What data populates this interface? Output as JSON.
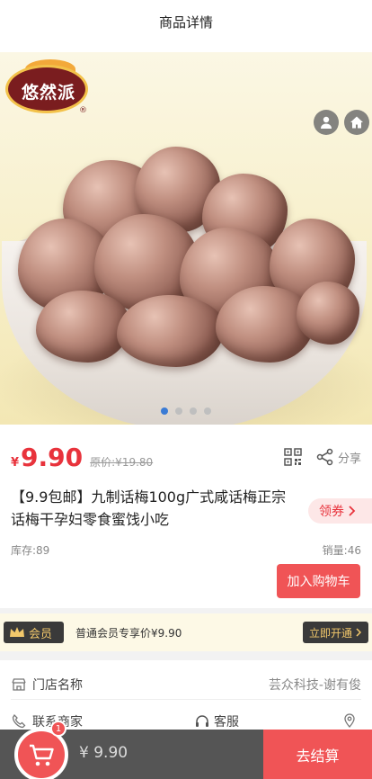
{
  "header": {
    "title": "商品详情"
  },
  "hero": {
    "brand_text": "悠然派",
    "reg_mark": "®",
    "slides": 4,
    "active_slide": 1
  },
  "product": {
    "currency": "¥",
    "price": "9.90",
    "original_price": "原价:¥19.80",
    "title": "【9.9包邮】九制话梅100g广式咸话梅正宗话梅干孕妇零食蜜饯小吃",
    "coupon_label": "领券",
    "stock": "库存:89",
    "sales": "销量:46",
    "add_cart_label": "加入购物车",
    "share_label": "分享"
  },
  "member": {
    "tag_label": "会员",
    "description": "普通会员专享价¥9.90",
    "open_label": "立即开通"
  },
  "store": {
    "label": "门店名称",
    "name": "芸众科技-谢有俊",
    "contact_label": "联系商家",
    "service_label": "客服"
  },
  "cart": {
    "badge_count": "1",
    "total": "¥ 9.90",
    "checkout_label": "去结算"
  },
  "colors": {
    "accent": "#e8333c",
    "button": "#f05456",
    "member_bg": "#fdf9e6",
    "dot_active": "#3a7bd5"
  }
}
